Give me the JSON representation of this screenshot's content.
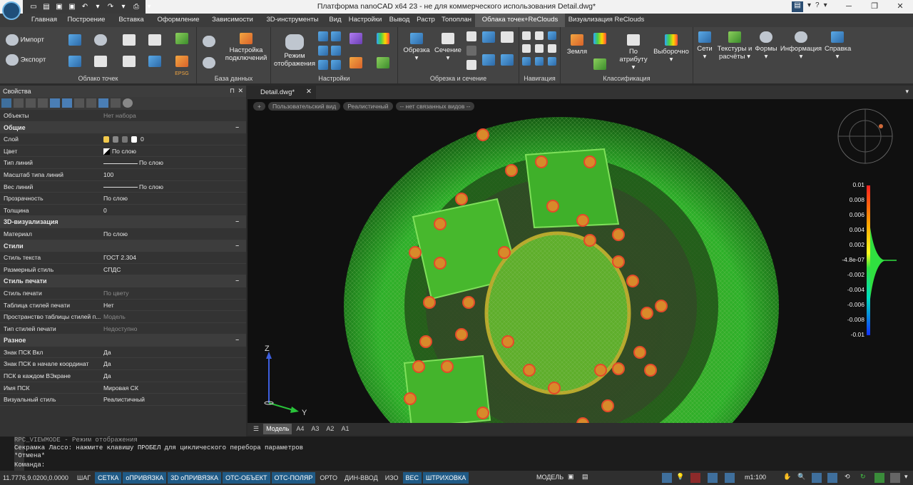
{
  "app": {
    "title": "Платформа nanoCAD x64 23 - не для коммерческого использования Detail.dwg*",
    "help_symbol": "?"
  },
  "menu_tabs": [
    "Главная",
    "Построение",
    "Вставка",
    "Оформление",
    "Зависимости",
    "3D-инструменты",
    "Вид",
    "Настройки",
    "Вывод",
    "Растр",
    "Топоплан",
    "Облака точек+ReClouds",
    "Визуализация ReClouds"
  ],
  "ribbon": {
    "groups": [
      {
        "label": "Облако точек"
      },
      {
        "label": "База данных"
      },
      {
        "label": "Настройки"
      },
      {
        "label": "Обрезка и сечение"
      },
      {
        "label": "Навигация"
      },
      {
        "label": "Классификация"
      }
    ],
    "buttons": {
      "import": "Импорт",
      "export": "Экспорт",
      "epsg": "EPSG",
      "connection_settings": "Настройка подключений",
      "display_mode": "Режим отображения",
      "clip": "Обрезка",
      "section": "Сечение",
      "ground": "Земля",
      "by_attribute": "По атрибуту",
      "selective": "Выборочно",
      "meshes": "Сети",
      "textures": "Текстуры и расчёты",
      "shapes": "Формы",
      "info": "Информация",
      "help": "Справка"
    }
  },
  "properties": {
    "title": "Свойства",
    "rows": [
      {
        "type": "row",
        "k": "Объекты",
        "v": "Нет набора",
        "dim": true
      },
      {
        "type": "sec",
        "k": "Общие"
      },
      {
        "type": "row",
        "k": "Слой",
        "v": "0"
      },
      {
        "type": "row",
        "k": "Цвет",
        "v": "По слою"
      },
      {
        "type": "row",
        "k": "Тип линий",
        "v": "По слою"
      },
      {
        "type": "row",
        "k": "Масштаб типа линий",
        "v": "100"
      },
      {
        "type": "row",
        "k": "Вес линий",
        "v": "По слою"
      },
      {
        "type": "row",
        "k": "Прозрачность",
        "v": "По слою"
      },
      {
        "type": "row",
        "k": "Толщина",
        "v": "0"
      },
      {
        "type": "sec",
        "k": "3D-визуализация"
      },
      {
        "type": "row",
        "k": "Материал",
        "v": "По слою"
      },
      {
        "type": "sec",
        "k": "Стили"
      },
      {
        "type": "row",
        "k": "Стиль текста",
        "v": "ГОСТ 2.304"
      },
      {
        "type": "row",
        "k": "Размерный стиль",
        "v": "СПДС"
      },
      {
        "type": "sec",
        "k": "Стиль печати"
      },
      {
        "type": "row",
        "k": "Стиль печати",
        "v": "По цвету",
        "dim": true
      },
      {
        "type": "row",
        "k": "Таблица стилей печати",
        "v": "Нет"
      },
      {
        "type": "row",
        "k": "Пространство таблицы стилей п...",
        "v": "Модель",
        "dim": true
      },
      {
        "type": "row",
        "k": "Тип стилей печати",
        "v": "Недоступно",
        "dim": true
      },
      {
        "type": "sec",
        "k": "Разное"
      },
      {
        "type": "row",
        "k": "Знак ПСК Вкл",
        "v": "Да"
      },
      {
        "type": "row",
        "k": "Знак ПСК в начале координат",
        "v": "Да"
      },
      {
        "type": "row",
        "k": "ПСК в каждом ВЭкране",
        "v": "Да"
      },
      {
        "type": "row",
        "k": "Имя ПСК",
        "v": "Мировая СК"
      },
      {
        "type": "row",
        "k": "Визуальный стиль",
        "v": "Реалистичный"
      }
    ]
  },
  "document": {
    "tab": "Detail.dwg*",
    "view_chips": [
      "+",
      "Пользовательский вид",
      "Реалистичный",
      "-- нет связанных видов --"
    ],
    "layout_tabs": [
      "Модель",
      "A4",
      "A3",
      "A2",
      "A1"
    ],
    "axis_z": "Z",
    "axis_y": "Y",
    "colorbar_labels": [
      "0.01",
      "0.008",
      "0.006",
      "0.004",
      "0.002",
      "-4.8e-07",
      "-0.002",
      "-0.004",
      "-0.006",
      "-0.008",
      "-0.01"
    ]
  },
  "command": {
    "lines": [
      "RPC_VIEWMODE - Режим отображения",
      "Секрамка Лассо: нажмите клавишу ПРОБЕЛ для циклического перебора параметров",
      "*Отмена*",
      "Команда:"
    ]
  },
  "status": {
    "coords": "11.7776,9.0200,0.0000",
    "buttons": [
      {
        "label": "ШАГ",
        "on": false
      },
      {
        "label": "СЕТКА",
        "on": true
      },
      {
        "label": "оПРИВЯЗКА",
        "on": true
      },
      {
        "label": "3D оПРИВЯЗКА",
        "on": true
      },
      {
        "label": "ОТС-ОБЪЕКТ",
        "on": true
      },
      {
        "label": "ОТС-ПОЛЯР",
        "on": true
      },
      {
        "label": "ОРТО",
        "on": false
      },
      {
        "label": "ДИН-ВВОД",
        "on": false
      },
      {
        "label": "ИЗО",
        "on": false
      },
      {
        "label": "ВЕС",
        "on": true
      },
      {
        "label": "ШТРИХОВКА",
        "on": true
      }
    ],
    "model": "МОДЕЛЬ",
    "scale": "m1:100"
  }
}
